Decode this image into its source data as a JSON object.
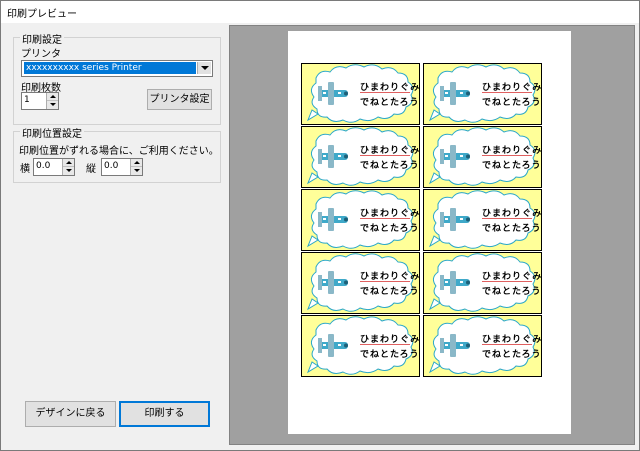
{
  "window": {
    "title": "印刷プレビュー"
  },
  "print_settings": {
    "group_title": "印刷設定",
    "printer_label": "プリンタ",
    "printer_value": "xxxxxxxxxx series Printer",
    "copies_label": "印刷枚数",
    "copies_value": "1",
    "printer_settings_button": "プリンタ設定"
  },
  "position_settings": {
    "group_title": "印刷位置設定",
    "hint": "印刷位置がずれる場合に、ご利用ください。",
    "horizontal_label": "横",
    "horizontal_value": "0.0",
    "vertical_label": "縦",
    "vertical_value": "0.0"
  },
  "buttons": {
    "back_to_design": "デザインに戻る",
    "print": "印刷する"
  },
  "preview": {
    "labels": [
      {
        "line1": "ひまわりぐみ",
        "line2": "でねとたろう"
      },
      {
        "line1": "ひまわりぐみ",
        "line2": "でねとたろう"
      },
      {
        "line1": "ひまわりぐみ",
        "line2": "でねとたろう"
      },
      {
        "line1": "ひまわりぐみ",
        "line2": "でねとたろう"
      },
      {
        "line1": "ひまわりぐみ",
        "line2": "でねとたろう"
      },
      {
        "line1": "ひまわりぐみ",
        "line2": "でねとたろう"
      },
      {
        "line1": "ひまわりぐみ",
        "line2": "でねとたろう"
      },
      {
        "line1": "ひまわりぐみ",
        "line2": "でねとたろう"
      },
      {
        "line1": "ひまわりぐみ",
        "line2": "でねとたろう"
      },
      {
        "line1": "ひまわりぐみ",
        "line2": "でねとたろう"
      }
    ],
    "colors": {
      "label_background": "#ffff99",
      "cloud": "#ffffff",
      "cloud_outline": "#2aa7c9",
      "airplane": "#3fa9c9",
      "name_underline": "#e06060"
    }
  }
}
